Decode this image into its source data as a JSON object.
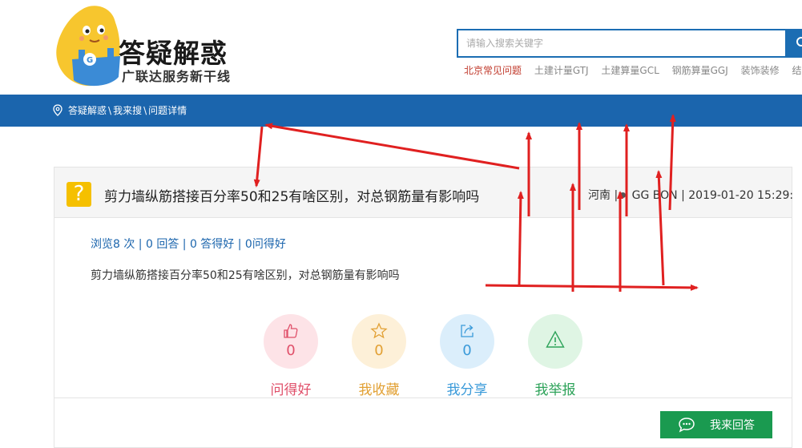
{
  "header": {
    "logo_title": "答疑解惑",
    "logo_subtitle": "广联达服务新干线",
    "search_placeholder": "请输入搜索关键字",
    "quick_links": [
      "北京常见问题",
      "土建计量GTJ",
      "土建算量GCL",
      "钢筋算量GGJ",
      "装饰装修",
      "结算"
    ]
  },
  "breadcrumb": [
    "答疑解惑",
    "我来搜",
    "问题详情"
  ],
  "question": {
    "title": "剪力墙纵筋搭接百分率50和25有啥区别，对总钢筋量有影响吗",
    "region": "河南",
    "author": "GG BON",
    "datetime": "2019-01-20 15:29:",
    "stats": "浏览8 次 | 0 回答 | 0 答得好 | 0问得好",
    "body": "剪力墙纵筋搭接百分率50和25有啥区别，对总钢筋量有影响吗"
  },
  "actions": [
    {
      "label": "问得好",
      "count": "0",
      "icon": "thumb-up-icon",
      "color": "#e0506a"
    },
    {
      "label": "我收藏",
      "count": "0",
      "icon": "star-icon",
      "color": "#e2a033"
    },
    {
      "label": "我分享",
      "count": "0",
      "icon": "share-icon",
      "color": "#3a9ad9"
    },
    {
      "label": "我举报",
      "count": "",
      "icon": "warning-icon",
      "color": "#2ea35a"
    }
  ],
  "answer_button": "我来回答",
  "colors": {
    "nav_blue": "#1b65ad",
    "answer_green": "#1a9a50",
    "annotation_red": "#e02020"
  }
}
